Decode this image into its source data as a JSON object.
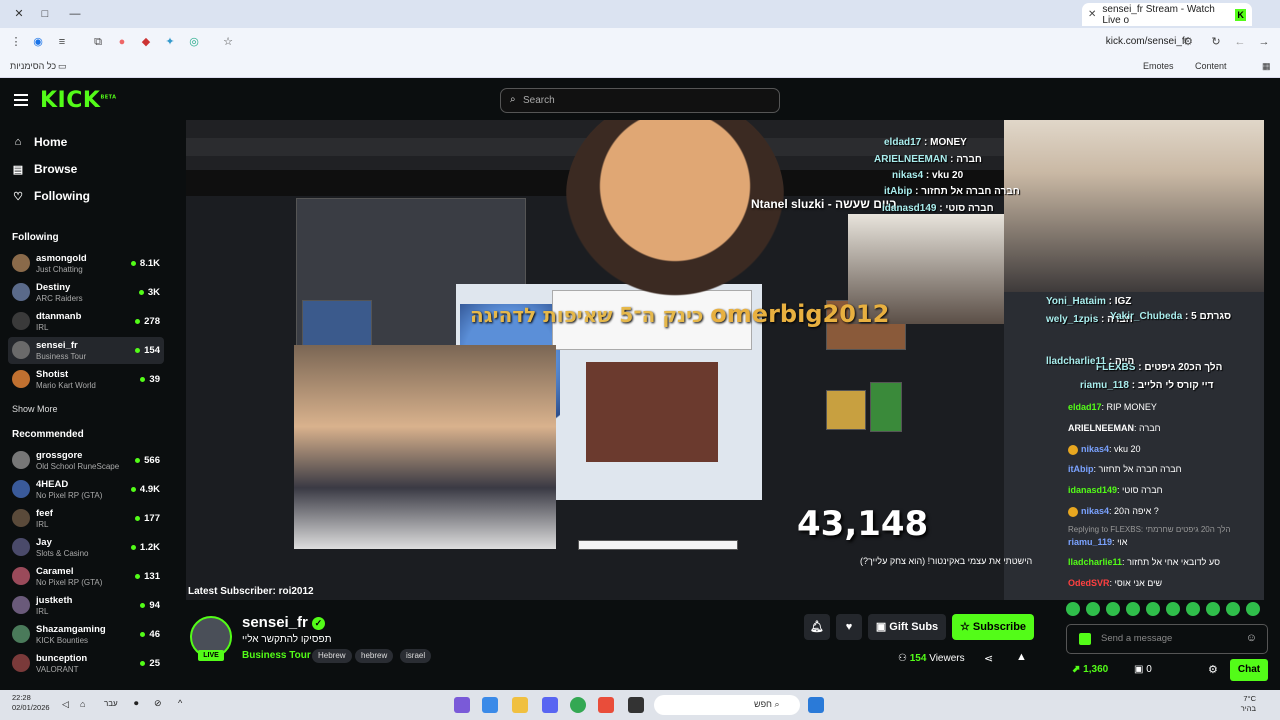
{
  "browser": {
    "tab_title": "sensei_fr Stream - Watch Live o",
    "url": "kick.com/sensei_fr",
    "bookmarks_folder": "כל הסימניות",
    "bookmark_emotes": "Emotes",
    "bookmark_content": "Content"
  },
  "header": {
    "logo": "KICK",
    "logo_sup": "BETA",
    "search_placeholder": "Search"
  },
  "sidebar": {
    "nav": [
      {
        "label": "Home",
        "icon": "home-icon"
      },
      {
        "label": "Browse",
        "icon": "browse-icon"
      },
      {
        "label": "Following",
        "icon": "heart-icon"
      }
    ],
    "following_title": "Following",
    "following": [
      {
        "name": "asmongold",
        "category": "Just Chatting",
        "viewers": "8.1K",
        "color": "#8a6a4a"
      },
      {
        "name": "Destiny",
        "category": "ARC Raiders",
        "viewers": "3K",
        "color": "#5a6a8a"
      },
      {
        "name": "dtanmanb",
        "category": "IRL",
        "viewers": "278",
        "color": "#3a3a3a"
      },
      {
        "name": "sensei_fr",
        "category": "Business Tour",
        "viewers": "154",
        "color": "#6a6a6a"
      },
      {
        "name": "Shotist",
        "category": "Mario Kart World",
        "viewers": "39",
        "color": "#c07030"
      }
    ],
    "show_more": "Show More",
    "recommended_title": "Recommended",
    "recommended": [
      {
        "name": "grossgore",
        "category": "Old School RuneScape",
        "viewers": "566",
        "color": "#777"
      },
      {
        "name": "4HEAD",
        "category": "No Pixel RP (GTA)",
        "viewers": "4.9K",
        "color": "#3a5a9a"
      },
      {
        "name": "feef",
        "category": "IRL",
        "viewers": "177",
        "color": "#5a4a3a"
      },
      {
        "name": "Jay",
        "category": "Slots & Casino",
        "viewers": "1.2K",
        "color": "#4a4a6a"
      },
      {
        "name": "Caramel",
        "category": "No Pixel RP (GTA)",
        "viewers": "131",
        "color": "#9a4a5a"
      },
      {
        "name": "justketh",
        "category": "IRL",
        "viewers": "94",
        "color": "#6a5a7a"
      },
      {
        "name": "Shazamgaming",
        "category": "KICK Bounties",
        "viewers": "46",
        "color": "#4a7a5a"
      },
      {
        "name": "bunception",
        "category": "VALORANT",
        "viewers": "25",
        "color": "#7a3a3a"
      }
    ]
  },
  "stream": {
    "overlay_nick": "omerbig2012",
    "overlay_msg": "כינק ה־5 שאיפות לדהיגה",
    "count": "43,148",
    "ntanel": "Ntanel sluzki - ביום שעשה",
    "latest_sub": "Latest Subscriber: roi2012",
    "yt_title": "הישטתי את עצמי באקינטור! (הוא צחק עלייך?)",
    "overlay_chat": [
      {
        "user": "eldad17",
        "text": "MONEY"
      },
      {
        "user": "ARIELNEEMAN",
        "text": "חברה"
      },
      {
        "user": "nikas4",
        "text": "vku 20"
      },
      {
        "user": "itAbip",
        "text": "חברה חברה אל תחזור"
      },
      {
        "user": "idanasd149",
        "text": "חברה סוטי"
      },
      {
        "user": "Yoni_Hataim",
        "text": "IGZ"
      },
      {
        "user": "wely_1zpis",
        "text": "חברה"
      },
      {
        "user": "Yakir_Chubeda",
        "text": "סגרתם 5"
      },
      {
        "user": "FLEXBS",
        "text": "הלך הכ20 גיפטים"
      },
      {
        "user": "riamu_118",
        "text": "דיי קורס לי הלייב"
      },
      {
        "user": "lladcharlie11",
        "text": "הייה"
      }
    ]
  },
  "chat": {
    "messages": [
      {
        "user": "eldad17",
        "text": "RIP MONEY",
        "color": "#53fc18",
        "badge": false
      },
      {
        "user": "ARIELNEEMAN",
        "text": "חברה",
        "color": "#ffffff",
        "badge": false
      },
      {
        "user": "nikas4",
        "text": "vku 20",
        "color": "#7aa2ff",
        "badge": true
      },
      {
        "user": "itAbip",
        "text": "חברה חברה אל תחזור",
        "color": "#7aa2ff",
        "badge": false
      },
      {
        "user": "idanasd149",
        "text": "חברה סוטי",
        "color": "#53fc18",
        "badge": false
      },
      {
        "user": "nikas4",
        "text": "איפה ה20 ?",
        "color": "#7aa2ff",
        "badge": true
      },
      {
        "user": "riamu_119",
        "text": "אוי",
        "color": "#7aa2ff",
        "badge": false,
        "reply": "Replying to FLEXBS: הלך ה20 גיפטים שחרמתי"
      },
      {
        "user": "lladcharlie11",
        "text": "סע לדובאי אחי אל תחזור",
        "color": "#53fc18",
        "badge": false
      },
      {
        "user": "OdedSVR",
        "text": "שים אני אוסי",
        "color": "#ff4040",
        "badge": false
      }
    ],
    "input_placeholder": "Send a message",
    "points": "1,360",
    "zero": "0",
    "chat_button": "Chat"
  },
  "info": {
    "name": "sensei_fr",
    "title": "תפסיקו להתקשר אליי",
    "category": "Business Tour",
    "tags": [
      "Hebrew",
      "hebrew",
      "israel"
    ],
    "live": "LIVE",
    "gift_subs": "Gift Subs",
    "subscribe": "Subscribe",
    "viewers_count": "154",
    "viewers_label": "Viewers"
  },
  "taskbar": {
    "time": "22:28",
    "date": "02/01/2026",
    "lang": "עבר",
    "search": "חפש",
    "temp": "7°C",
    "weather": "בהיר"
  }
}
